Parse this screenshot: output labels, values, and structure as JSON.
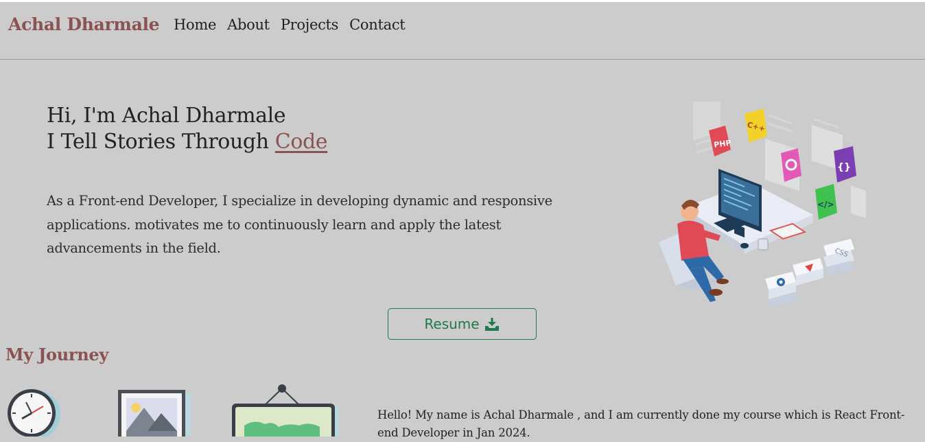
{
  "navbar": {
    "brand": "Achal Dharmale",
    "links": [
      "Home",
      "About",
      "Projects",
      "Contact"
    ]
  },
  "hero": {
    "line1": "Hi, I'm Achal Dharmale",
    "line2_prefix": "I Tell Stories Through ",
    "line2_highlight": "Code",
    "description": "As a Front-end Developer, I specialize in developing dynamic and responsive applications. motivates me to continuously learn and apply the latest advancements in the field.",
    "illustration_badges": [
      "PHP",
      "C++",
      "{}",
      "</>",
      "CSS"
    ]
  },
  "resume_button": {
    "label": "Resume",
    "icon": "download-icon"
  },
  "journey": {
    "title": "My Journey",
    "text": "Hello! My name is Achal Dharmale , and I am currently done my course which is React Front-end Developer in Jan 2024."
  },
  "colors": {
    "background": "#cccccc",
    "accent": "#8a5252",
    "button": "#1f7a4d"
  }
}
